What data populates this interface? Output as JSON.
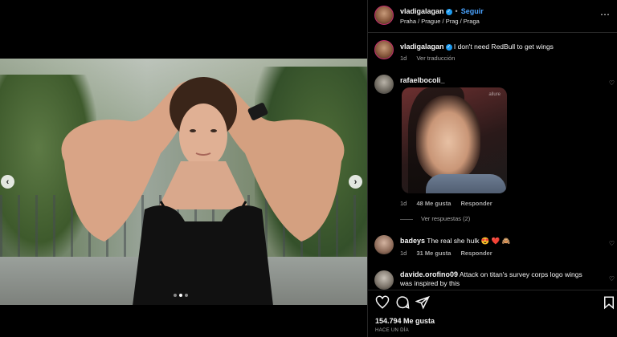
{
  "colors": {
    "accent": "#4aa3ff",
    "verified": "#1d9bf0",
    "muted": "#a8a8a8",
    "background": "#000000"
  },
  "post": {
    "author": "vladigalagan",
    "follow_label": "Seguir",
    "location": "Praha / Prague / Prag / Praga",
    "separator": "•",
    "media_dots": 3,
    "active_dot": 1
  },
  "caption": {
    "username": "vladigalagan",
    "text": "I don't need RedBull to get wings",
    "age": "1d",
    "translate_label": "Ver traducción"
  },
  "comments": [
    {
      "username": "rafaelbocoli_",
      "has_image": true,
      "image_watermark": "allure",
      "age": "1d",
      "likes": "48 Me gusta",
      "reply_label": "Responder",
      "view_replies": "Ver respuestas (2)"
    },
    {
      "username": "badeys",
      "text": "The real she hulk 😍 ❤️ 🙈",
      "age": "1d",
      "likes": "31 Me gusta",
      "reply_label": "Responder"
    },
    {
      "username": "davide.orofino09",
      "text_line1": "Attack on titan's survey corps logo wings",
      "text_line2": "was inspired by this"
    }
  ],
  "actions": {
    "icons": [
      "heart-icon",
      "comment-icon",
      "share-icon",
      "bookmark-icon"
    ],
    "likes_count": "154.794 Me gusta",
    "date": "HACE UN DÍA"
  }
}
